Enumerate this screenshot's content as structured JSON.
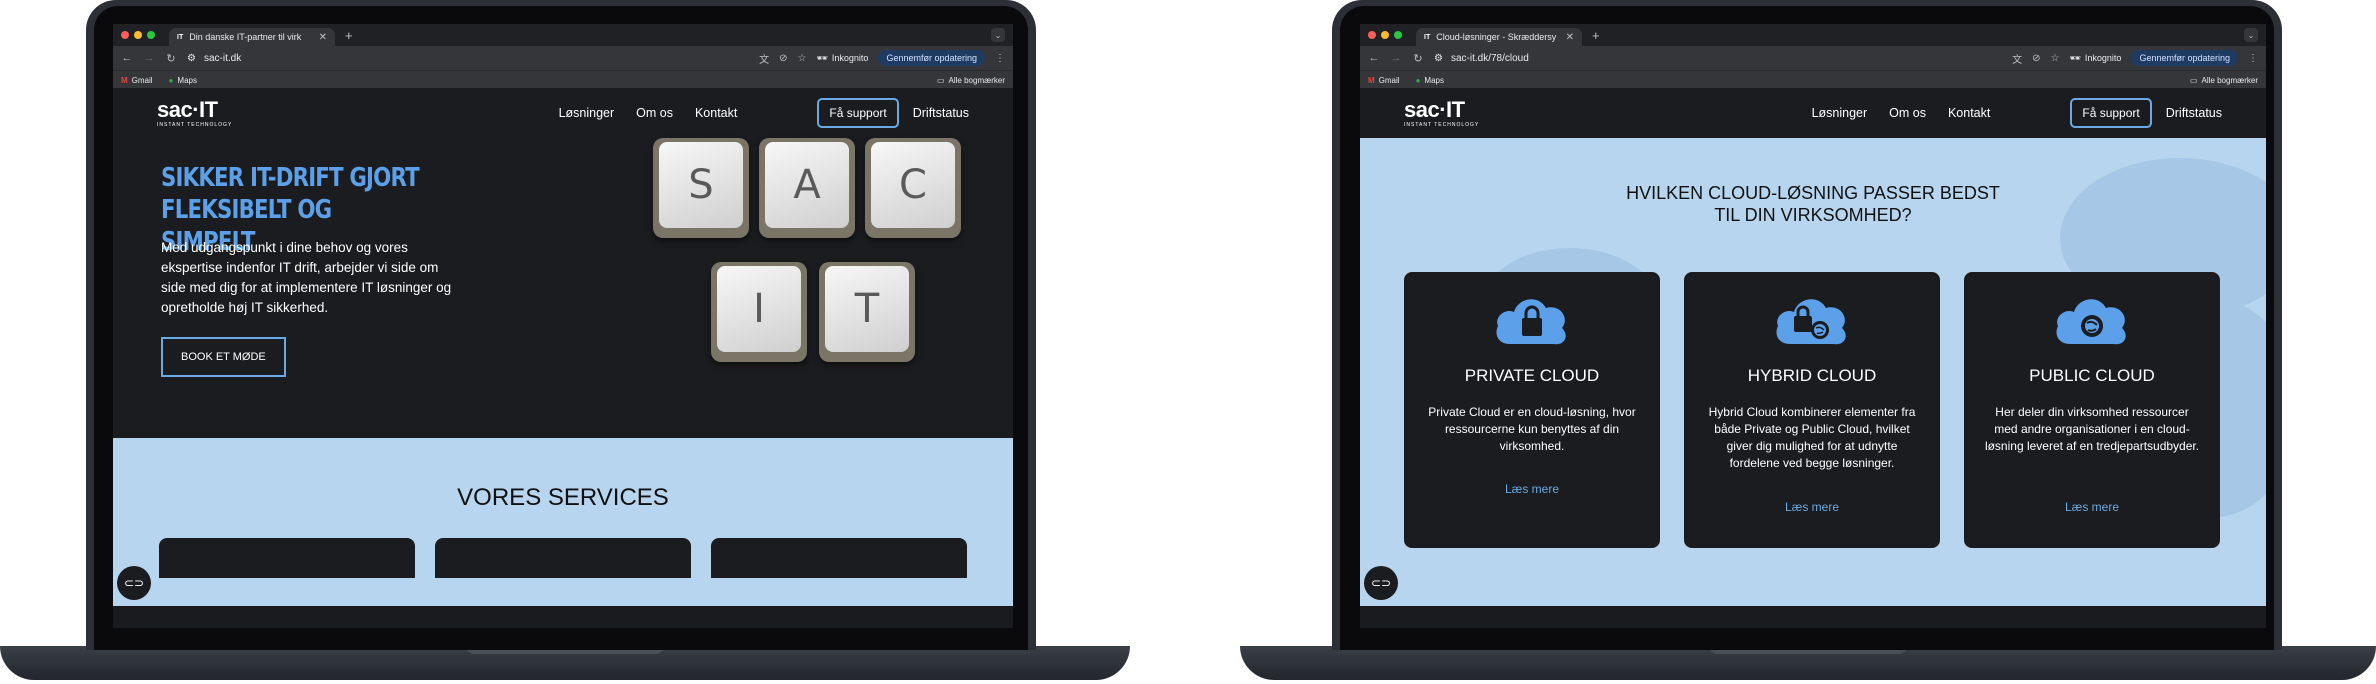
{
  "left": {
    "browser": {
      "tab_title": "Din danske IT-partner til virk",
      "tab_favicon": "IT",
      "url": "sac-it.dk",
      "incognito_label": "Inkognito",
      "update_label": "Gennemfør opdatering",
      "bookmarks": [
        "Gmail",
        "Maps"
      ],
      "all_bookmarks": "Alle bogmærker"
    },
    "site": {
      "logo": "sac·IT",
      "logo_sub": "INSTANT TECHNOLOGY",
      "nav": [
        "Løsninger",
        "Om os",
        "Kontakt"
      ],
      "support_button": "Få support",
      "status_link": "Driftstatus",
      "hero_title": "SIKKER IT-DRIFT GJORT FLEKSIBELT OG SIMPELT",
      "hero_text": "Med udgangspunkt i dine behov og vores ekspertise indenfor IT drift, arbejder vi side om side med dig for at implementere IT løsninger og opretholde høj IT sikkerhed.",
      "book_button": "BOOK ET MØDE",
      "keys": [
        "S",
        "A",
        "C",
        "I",
        "T"
      ],
      "services_title": "VORES SERVICES"
    }
  },
  "right": {
    "browser": {
      "tab_title": "Cloud-løsninger - Skræddersy",
      "tab_favicon": "IT",
      "url": "sac-it.dk/78/cloud",
      "incognito_label": "Inkognito",
      "update_label": "Gennemfør opdatering",
      "bookmarks": [
        "Gmail",
        "Maps"
      ],
      "all_bookmarks": "Alle bogmærker"
    },
    "site": {
      "logo": "sac·IT",
      "logo_sub": "INSTANT TECHNOLOGY",
      "nav": [
        "Løsninger",
        "Om os",
        "Kontakt"
      ],
      "support_button": "Få support",
      "status_link": "Driftstatus",
      "section_title_line1": "HVILKEN CLOUD-LØSNING PASSER BEDST",
      "section_title_line2": "TIL DIN VIRKSOMHED?",
      "cards": [
        {
          "title": "PRIVATE CLOUD",
          "text": "Private Cloud er en cloud-løsning, hvor ressourcerne kun benyttes af din virksomhed.",
          "link": "Læs mere",
          "icon": "cloud-lock-icon"
        },
        {
          "title": "HYBRID CLOUD",
          "text": "Hybrid Cloud kombinerer elementer fra både Private og Public Cloud, hvilket giver dig mulighed for at udnytte fordelene ved begge løsninger.",
          "link": "Læs mere",
          "icon": "cloud-lock-globe-icon"
        },
        {
          "title": "PUBLIC CLOUD",
          "text": "Her deler din virksomhed ressourcer med andre organisationer i en cloud-løsning leveret af en tredjepartsudbyder.",
          "link": "Læs mere",
          "icon": "cloud-globe-icon"
        }
      ]
    }
  },
  "colors": {
    "accent": "#5ba0e8",
    "dark_bg": "#1b1c1f",
    "light_section": "#b7d5ee"
  }
}
